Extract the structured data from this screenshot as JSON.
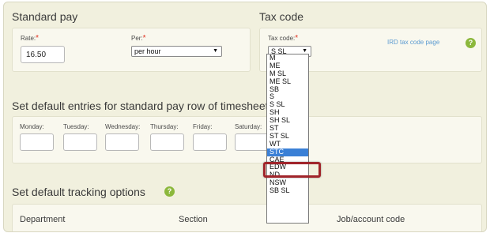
{
  "standard_pay": {
    "heading": "Standard pay",
    "rate_label": "Rate:",
    "rate_value": "16.50",
    "per_label": "Per:",
    "per_value": "per hour"
  },
  "tax_code": {
    "heading": "Tax code",
    "label": "Tax code:",
    "selected": "S SL",
    "ird_link": "IRD tax code page",
    "options": [
      "M",
      "ME",
      "M SL",
      "ME SL",
      "SB",
      "S",
      "S SL",
      "SH",
      "SH SL",
      "ST",
      "ST SL",
      "WT",
      "STC",
      "CAE",
      "EDW",
      "ND",
      "NSW",
      "SB SL"
    ],
    "highlighted_option": "STC"
  },
  "timesheet": {
    "heading": "Set default entries for standard pay row of timesheet",
    "days": [
      "Monday:",
      "Tuesday:",
      "Wednesday:",
      "Thursday:",
      "Friday:",
      "Saturday:"
    ]
  },
  "tracking": {
    "heading": "Set default tracking options",
    "columns": [
      "Department",
      "Section",
      "Job/account code"
    ]
  },
  "required_mark": "*",
  "help_glyph": "?",
  "colors": {
    "panel_bg": "#f1f0de",
    "link": "#5c9bd1",
    "help": "#8cb83c",
    "selection": "#3b80d6",
    "highlight_border": "#a0242a"
  }
}
